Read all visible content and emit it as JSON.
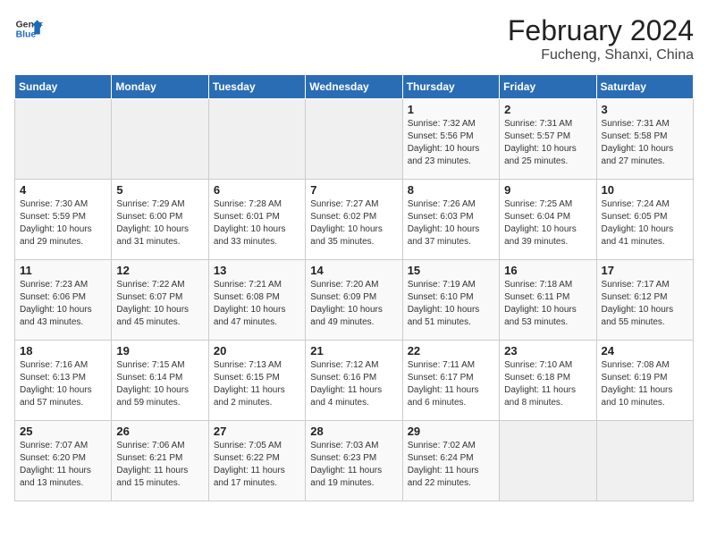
{
  "logo": {
    "line1": "General",
    "line2": "Blue"
  },
  "title": "February 2024",
  "subtitle": "Fucheng, Shanxi, China",
  "days_of_week": [
    "Sunday",
    "Monday",
    "Tuesday",
    "Wednesday",
    "Thursday",
    "Friday",
    "Saturday"
  ],
  "weeks": [
    [
      {
        "day": "",
        "info": ""
      },
      {
        "day": "",
        "info": ""
      },
      {
        "day": "",
        "info": ""
      },
      {
        "day": "",
        "info": ""
      },
      {
        "day": "1",
        "info": "Sunrise: 7:32 AM\nSunset: 5:56 PM\nDaylight: 10 hours and 23 minutes."
      },
      {
        "day": "2",
        "info": "Sunrise: 7:31 AM\nSunset: 5:57 PM\nDaylight: 10 hours and 25 minutes."
      },
      {
        "day": "3",
        "info": "Sunrise: 7:31 AM\nSunset: 5:58 PM\nDaylight: 10 hours and 27 minutes."
      }
    ],
    [
      {
        "day": "4",
        "info": "Sunrise: 7:30 AM\nSunset: 5:59 PM\nDaylight: 10 hours and 29 minutes."
      },
      {
        "day": "5",
        "info": "Sunrise: 7:29 AM\nSunset: 6:00 PM\nDaylight: 10 hours and 31 minutes."
      },
      {
        "day": "6",
        "info": "Sunrise: 7:28 AM\nSunset: 6:01 PM\nDaylight: 10 hours and 33 minutes."
      },
      {
        "day": "7",
        "info": "Sunrise: 7:27 AM\nSunset: 6:02 PM\nDaylight: 10 hours and 35 minutes."
      },
      {
        "day": "8",
        "info": "Sunrise: 7:26 AM\nSunset: 6:03 PM\nDaylight: 10 hours and 37 minutes."
      },
      {
        "day": "9",
        "info": "Sunrise: 7:25 AM\nSunset: 6:04 PM\nDaylight: 10 hours and 39 minutes."
      },
      {
        "day": "10",
        "info": "Sunrise: 7:24 AM\nSunset: 6:05 PM\nDaylight: 10 hours and 41 minutes."
      }
    ],
    [
      {
        "day": "11",
        "info": "Sunrise: 7:23 AM\nSunset: 6:06 PM\nDaylight: 10 hours and 43 minutes."
      },
      {
        "day": "12",
        "info": "Sunrise: 7:22 AM\nSunset: 6:07 PM\nDaylight: 10 hours and 45 minutes."
      },
      {
        "day": "13",
        "info": "Sunrise: 7:21 AM\nSunset: 6:08 PM\nDaylight: 10 hours and 47 minutes."
      },
      {
        "day": "14",
        "info": "Sunrise: 7:20 AM\nSunset: 6:09 PM\nDaylight: 10 hours and 49 minutes."
      },
      {
        "day": "15",
        "info": "Sunrise: 7:19 AM\nSunset: 6:10 PM\nDaylight: 10 hours and 51 minutes."
      },
      {
        "day": "16",
        "info": "Sunrise: 7:18 AM\nSunset: 6:11 PM\nDaylight: 10 hours and 53 minutes."
      },
      {
        "day": "17",
        "info": "Sunrise: 7:17 AM\nSunset: 6:12 PM\nDaylight: 10 hours and 55 minutes."
      }
    ],
    [
      {
        "day": "18",
        "info": "Sunrise: 7:16 AM\nSunset: 6:13 PM\nDaylight: 10 hours and 57 minutes."
      },
      {
        "day": "19",
        "info": "Sunrise: 7:15 AM\nSunset: 6:14 PM\nDaylight: 10 hours and 59 minutes."
      },
      {
        "day": "20",
        "info": "Sunrise: 7:13 AM\nSunset: 6:15 PM\nDaylight: 11 hours and 2 minutes."
      },
      {
        "day": "21",
        "info": "Sunrise: 7:12 AM\nSunset: 6:16 PM\nDaylight: 11 hours and 4 minutes."
      },
      {
        "day": "22",
        "info": "Sunrise: 7:11 AM\nSunset: 6:17 PM\nDaylight: 11 hours and 6 minutes."
      },
      {
        "day": "23",
        "info": "Sunrise: 7:10 AM\nSunset: 6:18 PM\nDaylight: 11 hours and 8 minutes."
      },
      {
        "day": "24",
        "info": "Sunrise: 7:08 AM\nSunset: 6:19 PM\nDaylight: 11 hours and 10 minutes."
      }
    ],
    [
      {
        "day": "25",
        "info": "Sunrise: 7:07 AM\nSunset: 6:20 PM\nDaylight: 11 hours and 13 minutes."
      },
      {
        "day": "26",
        "info": "Sunrise: 7:06 AM\nSunset: 6:21 PM\nDaylight: 11 hours and 15 minutes."
      },
      {
        "day": "27",
        "info": "Sunrise: 7:05 AM\nSunset: 6:22 PM\nDaylight: 11 hours and 17 minutes."
      },
      {
        "day": "28",
        "info": "Sunrise: 7:03 AM\nSunset: 6:23 PM\nDaylight: 11 hours and 19 minutes."
      },
      {
        "day": "29",
        "info": "Sunrise: 7:02 AM\nSunset: 6:24 PM\nDaylight: 11 hours and 22 minutes."
      },
      {
        "day": "",
        "info": ""
      },
      {
        "day": "",
        "info": ""
      }
    ]
  ]
}
